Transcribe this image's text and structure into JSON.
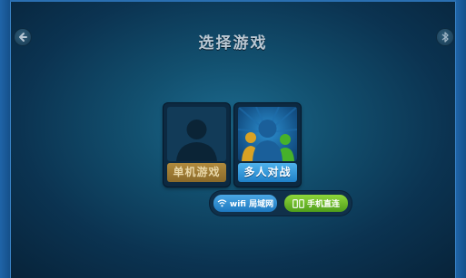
{
  "header": {
    "title": "选择游戏",
    "back_icon": "back-arrow-icon",
    "bluetooth_icon": "bluetooth-icon"
  },
  "modes": [
    {
      "label": "单机游戏",
      "icon": "single-user-icon",
      "state": "disabled"
    },
    {
      "label": "多人对战",
      "icon": "multi-user-icon",
      "state": "active"
    }
  ],
  "connection_options": [
    {
      "label": "wifi 局域网",
      "icon": "wifi-icon",
      "color": "#2a8fd6"
    },
    {
      "label": "手机直连",
      "icon": "phone-link-icon",
      "color": "#67b62a"
    }
  ],
  "colors": {
    "accent_blue": "#2a8fd6",
    "accent_green": "#67b62a",
    "disabled_gold": "#9a7836",
    "background": "#0b3351"
  }
}
